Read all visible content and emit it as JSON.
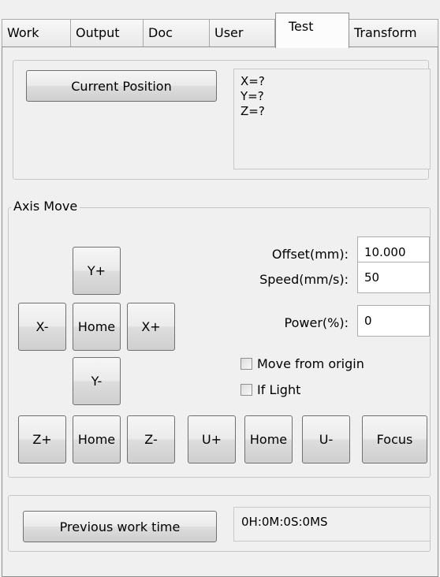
{
  "tabs": [
    {
      "label": "Work"
    },
    {
      "label": "Output"
    },
    {
      "label": "Doc"
    },
    {
      "label": "User"
    },
    {
      "label": "Test"
    },
    {
      "label": "Transform"
    }
  ],
  "position": {
    "button_label": "Current Position",
    "x": "X=?",
    "y": "Y=?",
    "z": "Z=?"
  },
  "axis_move": {
    "title": "Axis Move",
    "buttons": {
      "y_plus": "Y+",
      "x_minus": "X-",
      "home_xy": "Home",
      "x_plus": "X+",
      "y_minus": "Y-",
      "z_plus": "Z+",
      "home_z": "Home",
      "z_minus": "Z-",
      "u_plus": "U+",
      "home_u": "Home",
      "u_minus": "U-",
      "focus": "Focus"
    },
    "offset_label": "Offset(mm):",
    "offset_value": "10.000",
    "speed_label": "Speed(mm/s):",
    "speed_value": "50",
    "power_label": "Power(%):",
    "power_value": "0",
    "move_from_origin_label": "Move from origin",
    "move_from_origin_checked": false,
    "if_light_label": "If Light",
    "if_light_checked": false
  },
  "work_time": {
    "button_label": "Previous work time",
    "value": "0H:0M:0S:0MS"
  }
}
